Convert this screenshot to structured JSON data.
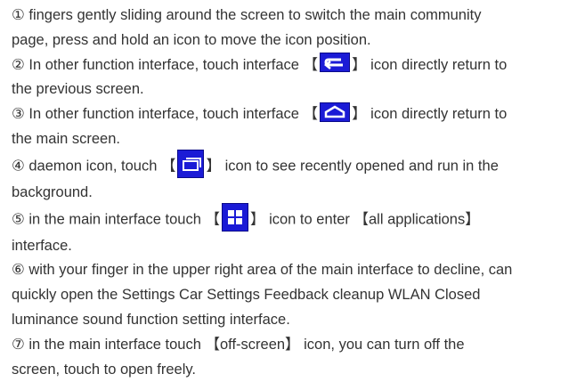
{
  "items": [
    {
      "lines": [
        "① fingers gently sliding around the screen to switch the main community",
        "page, press and hold an icon to move the icon position."
      ]
    },
    {
      "pre": "② In other function interface, touch interface 【",
      "post": "】 icon directly return to",
      "line2": "the previous screen.",
      "icon": "back-arrow-icon"
    },
    {
      "pre": "③ In other function interface, touch interface 【",
      "post": "】 icon directly return to",
      "line2": "the main screen.",
      "icon": "home-icon"
    },
    {
      "pre": "④ daemon icon, touch 【",
      "post": "】 icon to see recently opened and run in the",
      "line2": "background.",
      "icon": "recent-apps-icon"
    },
    {
      "pre": "⑤ in the main interface touch 【",
      "post": "】 icon to enter 【all applications】",
      "line2": "interface.",
      "icon": "all-apps-grid-icon"
    },
    {
      "lines": [
        "⑥ with your finger in the upper right area of the main interface to decline, can",
        "quickly open the Settings Car Settings Feedback cleanup WLAN Closed",
        "luminance sound function setting interface."
      ]
    },
    {
      "lines": [
        "⑦ in the main interface touch 【off-screen】 icon, you can turn off the",
        "screen, touch to open freely."
      ]
    }
  ],
  "colors": {
    "text": "#333333",
    "icon_bg": "#1b1bd6",
    "icon_fg": "#ffffff"
  }
}
